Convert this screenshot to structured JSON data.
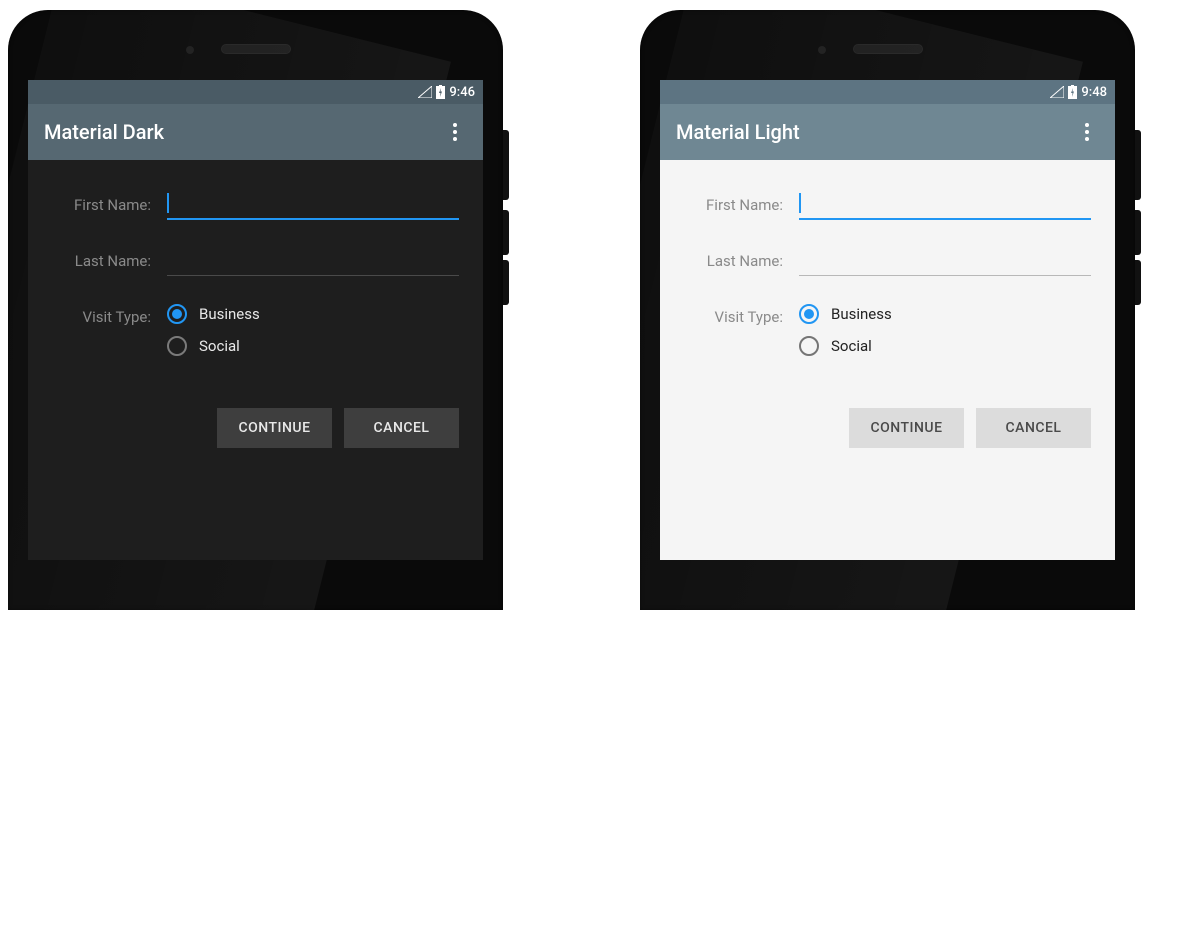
{
  "dark": {
    "status": {
      "time": "9:46"
    },
    "toolbar": {
      "title": "Material Dark"
    },
    "form": {
      "first_name_label": "First Name:",
      "first_name_value": "",
      "last_name_label": "Last Name:",
      "last_name_value": "",
      "visit_type_label": "Visit Type:",
      "business_label": "Business",
      "social_label": "Social"
    },
    "buttons": {
      "continue": "CONTINUE",
      "cancel": "CANCEL"
    }
  },
  "light": {
    "status": {
      "time": "9:48"
    },
    "toolbar": {
      "title": "Material Light"
    },
    "form": {
      "first_name_label": "First Name:",
      "first_name_value": "",
      "last_name_label": "Last Name:",
      "last_name_value": "",
      "visit_type_label": "Visit Type:",
      "business_label": "Business",
      "social_label": "Social"
    },
    "buttons": {
      "continue": "CONTINUE",
      "cancel": "CANCEL"
    }
  },
  "colors": {
    "accent": "#2196f3",
    "dark_bg": "#1e1e1e",
    "light_bg": "#f5f5f5",
    "dark_toolbar": "#566872",
    "light_toolbar": "#6f8793"
  }
}
